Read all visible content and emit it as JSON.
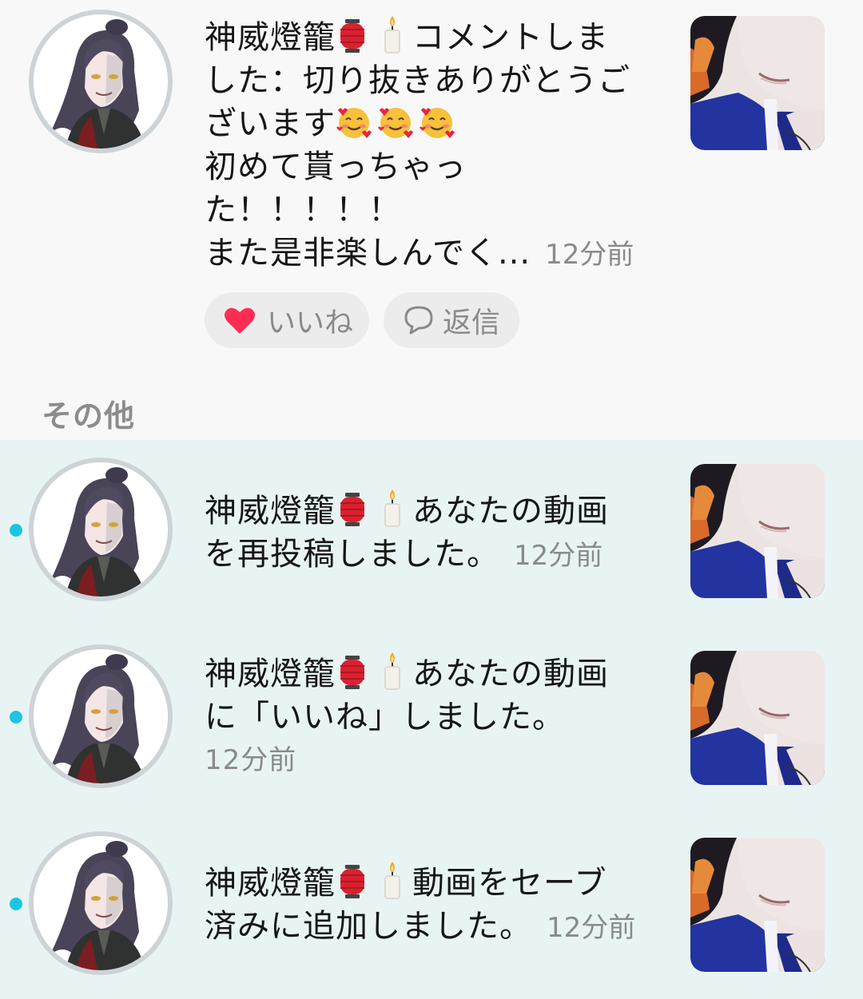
{
  "top_notification": {
    "username": "神威燈籠",
    "action": "コメントしました：切り抜きありがとうございます",
    "line1": "コメントしま",
    "line2": "した：切り抜きありがとうご",
    "line3": "ざいます",
    "line4": "初めて貰っちゃっ",
    "line5": "た！！！！！",
    "line6": "また是非楽しんでく...",
    "time": "12分前",
    "like_label": "いいね",
    "reply_label": "返信"
  },
  "section": {
    "title": "その他"
  },
  "others": [
    {
      "username": "神威燈籠",
      "line1": "あなたの動画",
      "line2": "を再投稿しました。",
      "time": "12分前",
      "unread": true
    },
    {
      "username": "神威燈籠",
      "line1": "あなたの動画",
      "line2": "に「いいね」しました。",
      "time": "12分前",
      "unread": true
    },
    {
      "username": "神威燈籠",
      "line1": "動画をセーブ",
      "line2": "済みに追加しました。",
      "time": "12分前",
      "unread": true
    }
  ],
  "colors": {
    "heart": "#fe2c55",
    "unread_dot": "#1ec5e0",
    "other_bg": "#e8f4f4",
    "lantern": "#d9212f"
  },
  "icons": [
    "avatar",
    "lantern-emoji",
    "candle-emoji",
    "smiling-hearts-emoji",
    "heart-icon",
    "comment-bubble-icon",
    "video-thumbnail"
  ]
}
